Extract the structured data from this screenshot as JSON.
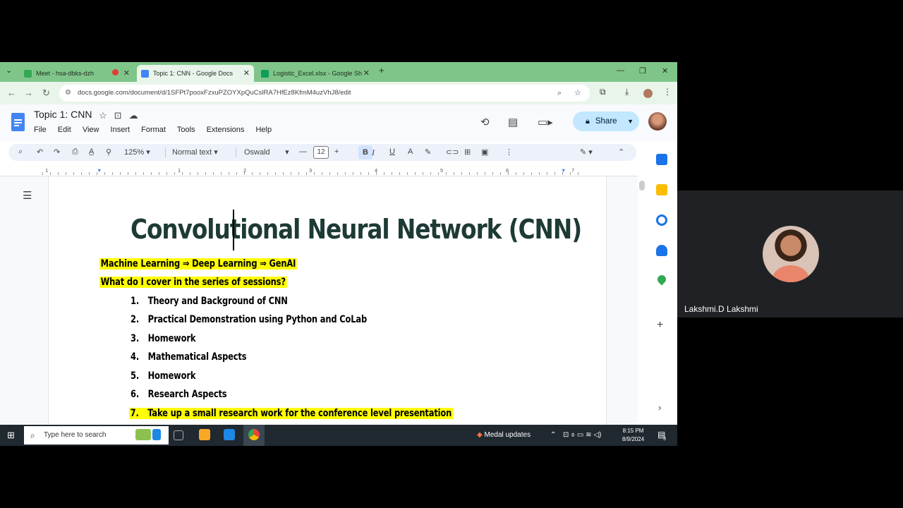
{
  "browser": {
    "tabs": [
      {
        "label": "Meet - hsa-dbks-dzh",
        "favicon_color": "#34a853"
      },
      {
        "label": "Topic 1: CNN - Google Docs",
        "favicon_color": "#4285f4"
      },
      {
        "label": "Logistic_Excel.xlsx - Google Sh",
        "favicon_color": "#0f9d58"
      }
    ],
    "new_tab": "+",
    "url": "docs.google.com/document/d/1SFPt7pooxFzxuPZOYXpQuCslRA7HfEz8KfmM4uzVhJ8/edit"
  },
  "docs": {
    "title": "Topic 1: CNN",
    "menu": [
      "File",
      "Edit",
      "View",
      "Insert",
      "Format",
      "Tools",
      "Extensions",
      "Help"
    ],
    "share_label": "Share",
    "toolbar": {
      "zoom": "125%",
      "style": "Normal text",
      "font": "Oswald",
      "font_size": "12",
      "bold": "B",
      "italic": "I",
      "underline": "U",
      "text_color": "A"
    },
    "ruler_marks": [
      "1",
      "1",
      "2",
      "3",
      "4",
      "5",
      "6",
      "7"
    ]
  },
  "document": {
    "heading": "Convolutional Neural Network (CNN)",
    "line1": "Machine Learning ⇒ Deep Learning ⇒ GenAI",
    "line2": "What do I cover in the series of sessions?",
    "items": [
      {
        "num": "1.",
        "text": "Theory and Background of CNN"
      },
      {
        "num": "2.",
        "text": "Practical Demonstration using Python and CoLab"
      },
      {
        "num": "3.",
        "text": "Homework"
      },
      {
        "num": "4.",
        "text": "Mathematical Aspects"
      },
      {
        "num": "5.",
        "text": "Homework"
      },
      {
        "num": "6.",
        "text": "Research Aspects"
      },
      {
        "num": "7.",
        "text": "Take up a small research work for the conference level presentation"
      }
    ],
    "highlight_color": "#ffff00"
  },
  "taskbar": {
    "search_placeholder": "Type here to search",
    "notification": "Medal updates",
    "time": "8:15 PM",
    "date": "8/9/2024",
    "badge": "3"
  },
  "meet": {
    "participant_name": "Lakshmi.D Lakshmi"
  }
}
